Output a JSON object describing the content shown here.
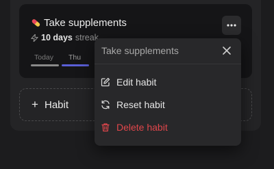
{
  "habit": {
    "title": "Take supplements",
    "emoji": "pill-icon",
    "streak_prefix": "",
    "streak_value": "10 days",
    "streak_suffix": "streak",
    "days": [
      {
        "label": "Today"
      },
      {
        "label": "Thu"
      }
    ]
  },
  "add_habit": {
    "label": "Habit"
  },
  "menu": {
    "title": "Take supplements",
    "items": [
      {
        "label": "Edit habit",
        "icon": "edit-icon"
      },
      {
        "label": "Reset habit",
        "icon": "refresh-icon"
      },
      {
        "label": "Delete habit",
        "icon": "trash-icon"
      }
    ]
  },
  "colors": {
    "accent": "#5a5fd6",
    "danger": "#e0464b",
    "background": "#1c1c1e",
    "card": "#151517"
  }
}
